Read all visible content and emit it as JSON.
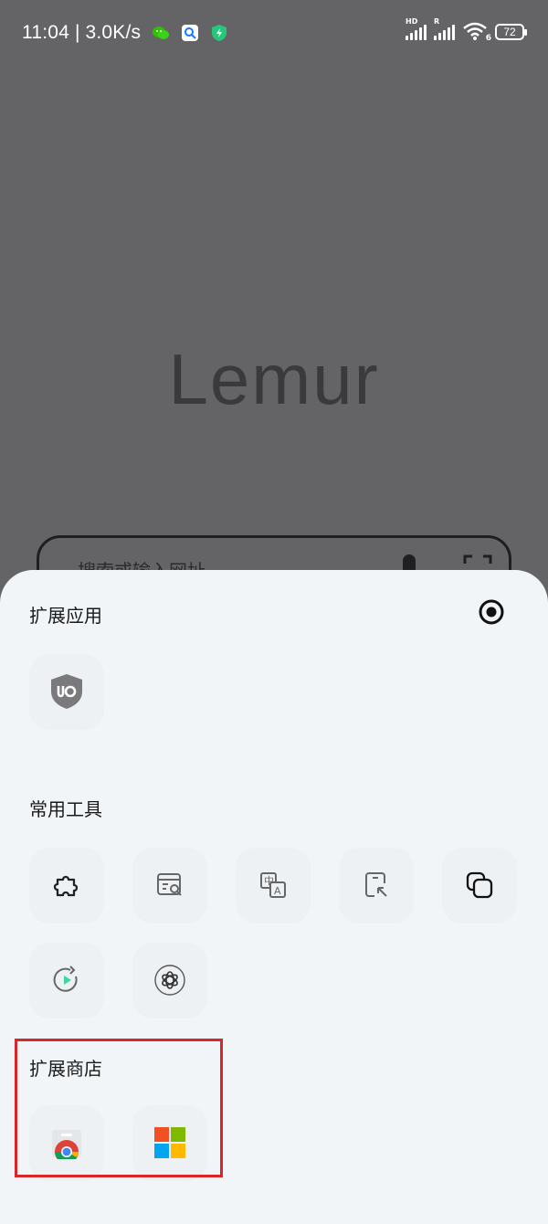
{
  "status_bar": {
    "time": "11:04",
    "separator": "|",
    "speed": "3.0K/s",
    "notification_icons": [
      "wechat-icon",
      "image-search-icon",
      "shield-app-icon"
    ],
    "signal_1_tag": "HD",
    "signal_2_tag": "R",
    "wifi_tag": "6",
    "battery": "72"
  },
  "browser": {
    "logo": "Lemur",
    "search_placeholder": "搜索或输入网址"
  },
  "sheet": {
    "extensions_title": "扩展应用",
    "extensions": [
      {
        "icon": "ublock-origin-icon"
      }
    ],
    "tools_title": "常用工具",
    "tools": [
      {
        "icon": "puzzle-extension-icon"
      },
      {
        "icon": "page-search-icon"
      },
      {
        "icon": "translate-icon"
      },
      {
        "icon": "screenshot-select-icon"
      },
      {
        "icon": "multi-window-icon"
      },
      {
        "icon": "video-sync-icon"
      },
      {
        "icon": "ai-assistant-icon"
      }
    ],
    "store_title": "扩展商店",
    "stores": [
      {
        "icon": "chrome-web-store-icon"
      },
      {
        "icon": "microsoft-edge-store-icon"
      }
    ]
  },
  "colors": {
    "overlay": "#646466",
    "sheet": "#f2f5f8",
    "tile": "#eef1f4",
    "highlight": "#d9262a",
    "ms_red": "#f25022",
    "ms_green": "#7fba00",
    "ms_blue": "#00a4ef",
    "ms_yellow": "#ffb900"
  }
}
